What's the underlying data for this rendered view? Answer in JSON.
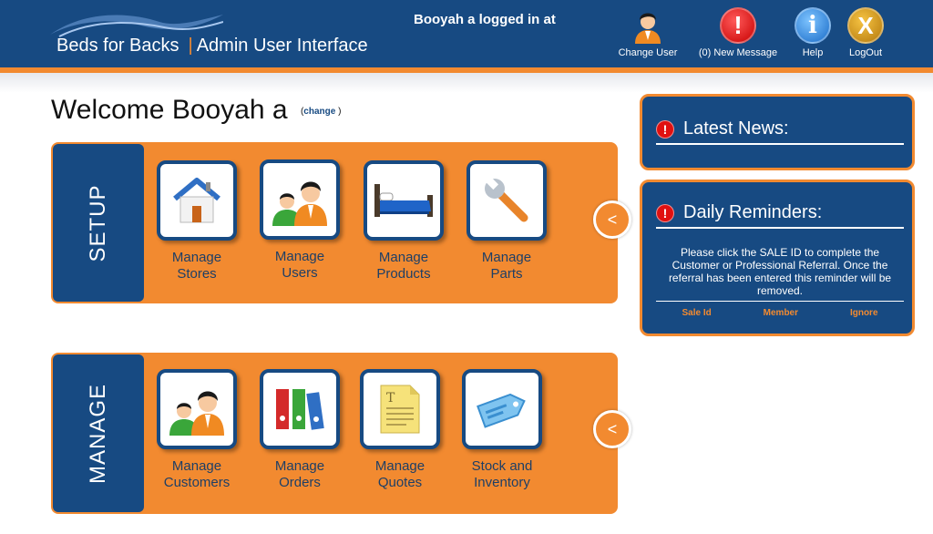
{
  "header": {
    "brand": "Beds for Backs",
    "subtitle": "Admin User Interface",
    "login_status": "Booyah a logged in at",
    "buttons": {
      "change_user": "Change User",
      "messages": "(0) New Message",
      "help": "Help",
      "logout": "LogOut"
    },
    "icon_glyphs": {
      "messages": "!",
      "help": "i",
      "logout": "X"
    }
  },
  "welcome": {
    "text": "Welcome Booyah a",
    "change_open": "(",
    "change_link": "change",
    "change_close": ")"
  },
  "setup": {
    "label": "SETUP",
    "tiles": [
      {
        "line1": "Manage",
        "line2": "Stores",
        "icon": "store-icon"
      },
      {
        "line1": "Manage",
        "line2": "Users",
        "icon": "users-icon"
      },
      {
        "line1": "Manage",
        "line2": "Products",
        "icon": "bed-icon"
      },
      {
        "line1": "Manage",
        "line2": "Parts",
        "icon": "wrench-icon"
      }
    ],
    "collapse_glyph": "<"
  },
  "manage": {
    "label": "MANAGE",
    "tiles": [
      {
        "line1": "Manage",
        "line2": "Customers",
        "icon": "customers-icon"
      },
      {
        "line1": "Manage",
        "line2": "Orders",
        "icon": "binders-icon"
      },
      {
        "line1": "Manage",
        "line2": "Quotes",
        "icon": "document-icon"
      },
      {
        "line1": "Stock and",
        "line2": "Inventory",
        "icon": "tag-icon"
      }
    ],
    "collapse_glyph": "<"
  },
  "news": {
    "title": "Latest News:",
    "alert_glyph": "!"
  },
  "reminders": {
    "title": "Daily Reminders:",
    "alert_glyph": "!",
    "message": "Please click the SALE ID to complete the Customer or Professional Referral. Once the referral has been entered this reminder will be removed.",
    "columns": [
      "Sale Id",
      "Member",
      "Ignore"
    ]
  },
  "colors": {
    "navy": "#174a82",
    "orange": "#f28a30",
    "label_text": "#1e3f66"
  }
}
